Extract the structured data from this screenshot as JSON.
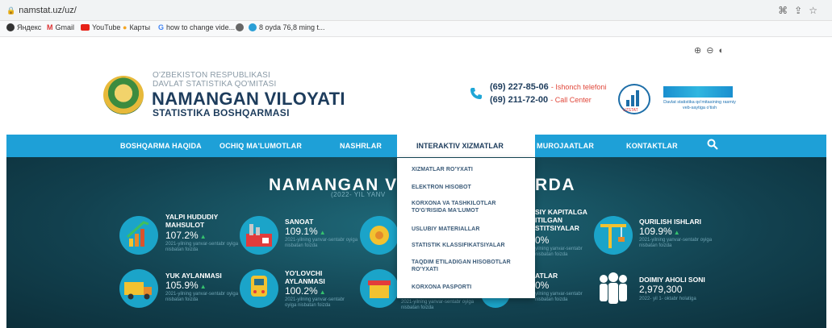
{
  "browser": {
    "url": "namstat.uz/uz/",
    "bookmarks": [
      "Яндекс",
      "Gmail",
      "YouTube",
      "Карты",
      "how to change vide...",
      "8 oyda 76,8 ming t..."
    ]
  },
  "header": {
    "org_line1": "O'ZBEKISTON RESPUBLIKASI",
    "org_line2": "DAVLAT STATISTIKA QO'MITASI",
    "title": "NAMANGAN VILOYATI",
    "subtitle": "STATISTIKA BOSHQARMASI",
    "phone1": "(69) 227-85-06",
    "phone1_label": "- Ishonch telefoni",
    "phone2": "(69) 211-72-00",
    "phone2_label": "- Call Center",
    "uzstat_label": "UZSTAT",
    "portal_text": "Davlat statistika qo'mitasining rasmiy veb-saytiga o'tish"
  },
  "nav": {
    "items": [
      "BOSHQARMA HAQIDA",
      "OCHIQ MA'LUMOTLAR",
      "NASHRLAR",
      "INTERAKTIV XIZMATLAR",
      "MUROJAATLAR",
      "KONTAKTLAR"
    ]
  },
  "dropdown": {
    "items": [
      "XIZMATLAR RO'YXATI",
      "ELEKTRON HISOBOT",
      "KORXONA VA TASHKILOTLAR TO'G'RISIDA MA'LUMOT",
      "USLUBIY MATERIALLAR",
      "STATISTIK KLASSIFIKATSIYALAR",
      "TAQDIM ETILADIGAN HISOBOTLAR RO'YXATI",
      "KORXONA PASPORTI"
    ]
  },
  "hero": {
    "title_left": "NAMANGAN VIL",
    "title_right": "RDA",
    "subtitle": "(2022- YIL YANV",
    "stats": [
      {
        "name": "YALPI HUDUDIY MAHSULOT",
        "value": "107.2%",
        "note": "2021-yilning yanvar-sentabr oyiga nisbatan foizda"
      },
      {
        "name": "SANOAT",
        "value": "109.1%",
        "note": "2021-yilning yanvar-sentabr oyiga nisbatan foizda"
      },
      {
        "name": "SIY KAPITALGA ITILGAN STITSIYALAR",
        "value": "0%",
        "note": "yilning yanvar-sentabr nisbatan foizda"
      },
      {
        "name": "QURILISH ISHLARI",
        "value": "109.9%",
        "note": "2021-yilning yanvar-sentabr oyiga nisbatan foizda"
      },
      {
        "name": "YUK AYLANMASI",
        "value": "105.9%",
        "note": "2021-yilning yanvar-sentabr oyiga nisbatan foizda"
      },
      {
        "name": "YO'LOVCHI AYLANMASI",
        "value": "100.2%",
        "note": "2021-yilning yanvar-sentabr oyiga nisbatan foizda"
      },
      {
        "name": "",
        "value": "",
        "note": "2021-yilning yanvar-sentabr oyiga nisbatan foizda"
      },
      {
        "name": "ATLAR",
        "value": "0%",
        "note": "yilning yanvar-sentabr nisbatan foizda"
      },
      {
        "name": "DOIMIY AHOLI SONI",
        "value": "2,979,300",
        "note": "2022- yil 1- oktabr holatiga"
      }
    ]
  }
}
